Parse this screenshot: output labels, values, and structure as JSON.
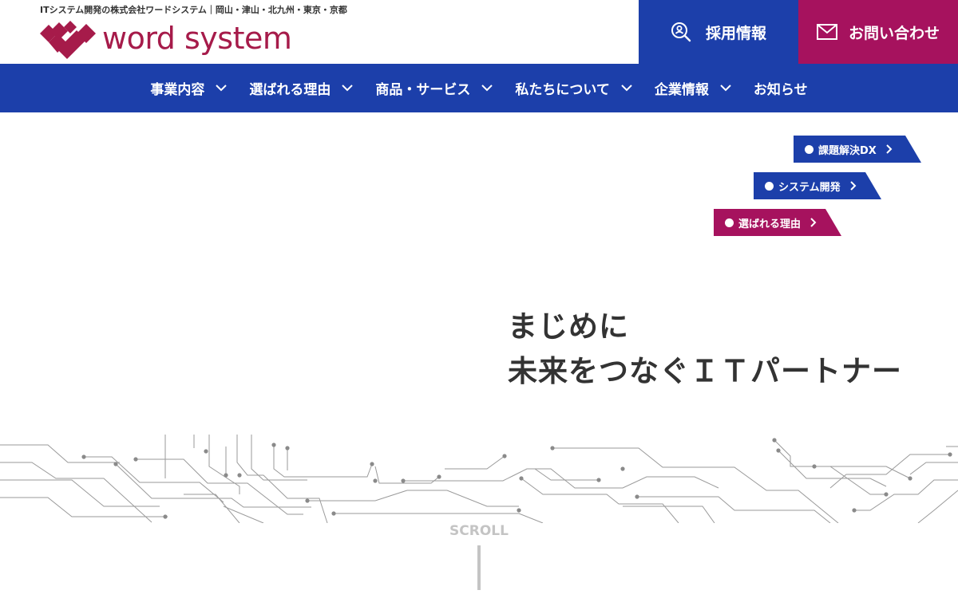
{
  "header": {
    "tagline": "ITシステム開発の株式会社ワードシステム｜岡山・津山・北九州・東京・京都",
    "logo_text": "word system",
    "recruit_label": "採用情報",
    "contact_label": "お問い合わせ"
  },
  "nav": {
    "items": [
      {
        "label": "事業内容",
        "icon": "chevron-down-icon"
      },
      {
        "label": "選ばれる理由",
        "icon": "chevron-down-icon"
      },
      {
        "label": "商品・サービス",
        "icon": "chevron-down-icon"
      },
      {
        "label": "私たちについて",
        "icon": "chevron-down-icon"
      },
      {
        "label": "企業情報",
        "icon": "chevron-down-icon"
      },
      {
        "label": "お知らせ"
      }
    ]
  },
  "tags": [
    {
      "label": "課題解決DX"
    },
    {
      "label": "システム開発"
    },
    {
      "label": "選ばれる理由"
    }
  ],
  "hero": {
    "line1": "まじめに",
    "line2": "未来をつなぐＩＴパートナー"
  },
  "scroll_label": "SCROLL",
  "colors": {
    "brand_blue": "#1c3faa",
    "brand_magenta": "#a6125e",
    "logo_red": "#a61b4a"
  }
}
